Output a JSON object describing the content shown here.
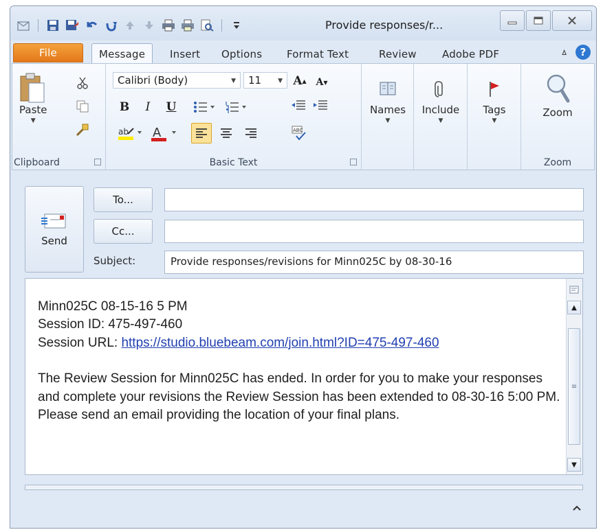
{
  "window": {
    "title": "Provide responses/r...",
    "accent": "#e3781a",
    "link_color": "#1f3fb0"
  },
  "quick_access": [
    "outlook-icon",
    "save-icon",
    "save-as-icon",
    "undo-icon",
    "redo-icon",
    "up-arrow-icon",
    "down-arrow-icon",
    "print-icon",
    "print-preview-icon",
    "find-icon",
    "customize-icon"
  ],
  "tabs": {
    "file": "File",
    "message": "Message",
    "insert": "Insert",
    "options": "Options",
    "format_text": "Format Text",
    "review": "Review",
    "adobe_pdf": "Adobe PDF",
    "collapse": "ㅿ",
    "help": "?"
  },
  "ribbon": {
    "clipboard": {
      "label": "Clipboard",
      "paste": "Paste"
    },
    "basic_text": {
      "label": "Basic Text",
      "font": "Calibri (Body)",
      "size": "11",
      "bold": "B",
      "italic": "I",
      "underline": "U"
    },
    "names": "Names",
    "include": "Include",
    "tags": "Tags",
    "zoom": {
      "button": "Zoom",
      "label": "Zoom"
    }
  },
  "header": {
    "send": "Send",
    "to": "To...",
    "cc": "Cc...",
    "subject_label": "Subject:",
    "to_value": "",
    "cc_value": "",
    "subject_value": "Provide responses/revisions for Minn025C by 08-30-16"
  },
  "body": {
    "line1": "Minn025C 08-15-16 5 PM",
    "line2": "Session ID: 475-497-460",
    "url_label": "Session URL: ",
    "url": "https://studio.bluebeam.com/join.html?ID=475-497-460",
    "paragraph": "The Review Session for Minn025C has ended.  In order for you to make your responses and complete your revisions the Review Session has been extended to 08-30-16 5:00 PM.  Please send an email providing the location of your final plans."
  }
}
